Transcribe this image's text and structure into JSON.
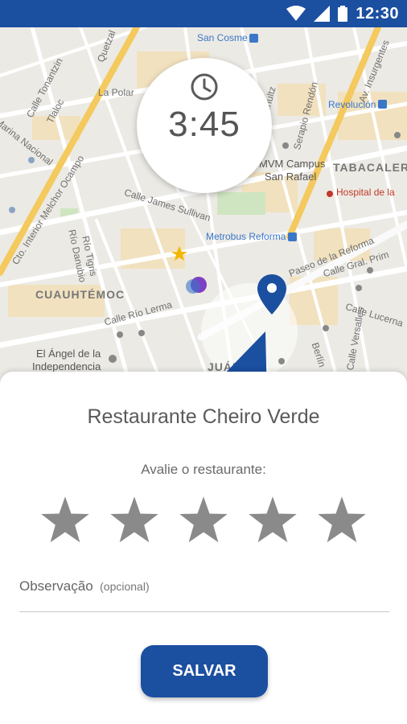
{
  "status_bar": {
    "time": "12:30",
    "background": "#1b4fa0",
    "icons": [
      "wifi-icon",
      "cellular-signal-icon",
      "battery-icon"
    ]
  },
  "map": {
    "labels": {
      "la_polar": "La Polar",
      "san_cosme": "San Cosme",
      "revolucion": "Revolución",
      "mvm_campus": "MVM Campus",
      "san_rafael": "San Rafael",
      "tabacalera": "TABACALER",
      "hospital": "Hospital de la",
      "james_sullivan": "Calle James Sullivan",
      "metrobus": "Metrobus Reforma",
      "paseo_reforma": "Paseo de la Reforma",
      "cuauhtemoc": "CUAUHTÉMOC",
      "rio_lerma": "Calle Río Lerma",
      "rio_tigris": "Río Tigris",
      "rio_danubio": "Río Danubio",
      "angel_1": "El Ángel de la",
      "angel_2": "Independencia",
      "calle_prim": "Calle Gral. Prim",
      "calle_lucerna": "Calle Lucerna",
      "calle_versalles": "Calle Versalles",
      "calle_berlin": "Berlín",
      "juarez": "JUÁREZ",
      "circuito": "Cto. Interior Melchor Ocampo",
      "tonantzin": "Calle Tonantzin",
      "tlaloc": "Tlaloc",
      "marina_nacional": "Marina Nacional",
      "quetzal": "Quetzal",
      "av_insurgentes": "Av. Insurgentes",
      "serapio": "Serapio Rendón",
      "schultz": "Schultz"
    }
  },
  "timer": {
    "icon": "clock-icon",
    "value": "3:45"
  },
  "sheet": {
    "restaurant_name": "Restaurante Cheiro Verde",
    "rating_prompt": "Avalie o restaurante:",
    "rating": 0,
    "max_rating": 5,
    "star_color": "#8a8a8a",
    "observation_label": "Observação",
    "observation_optional": "(opcional)",
    "save_label": "SALVAR",
    "accent": "#1b4fa0"
  }
}
